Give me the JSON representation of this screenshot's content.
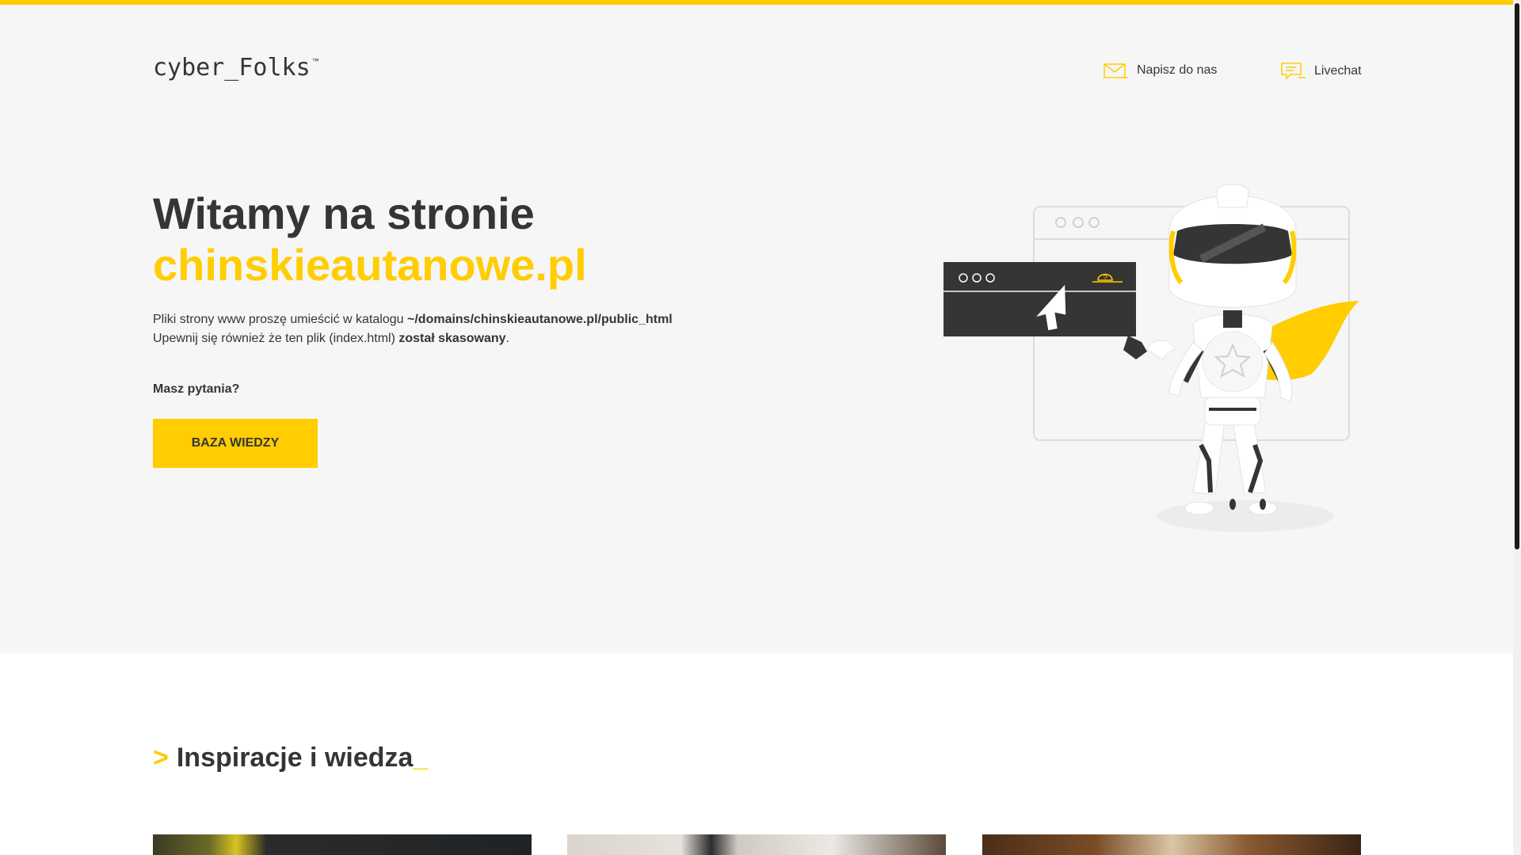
{
  "header": {
    "logo_text": "cyber_Folks",
    "logo_tm": "™",
    "contact_write": "Napisz do nas",
    "contact_chat": "Livechat"
  },
  "hero": {
    "title_line1": "Witamy na stronie",
    "title_domain": "chinskieautanowe.pl",
    "desc_line1_prefix": "Pliki strony www proszę umieścić w katalogu ",
    "desc_line1_path": "~/domains/chinskieautanowe.pl/public_html",
    "desc_line2_prefix": "Upewnij się również że ten plik (index.html) ",
    "desc_line2_bold": "został skasowany",
    "desc_line2_suffix": ".",
    "questions": "Masz pytania?",
    "button_label": "BAZA WIEDZY"
  },
  "section": {
    "prompt": ">",
    "title": "Inspiracje i wiedza",
    "cursor": "_"
  },
  "colors": {
    "accent": "#ffcd00",
    "text": "#353535",
    "hero_bg": "#f6f6f6"
  },
  "icons": {
    "write": "mail-icon",
    "chat": "chat-icon",
    "illustration": "robot-superhero-illustration"
  }
}
